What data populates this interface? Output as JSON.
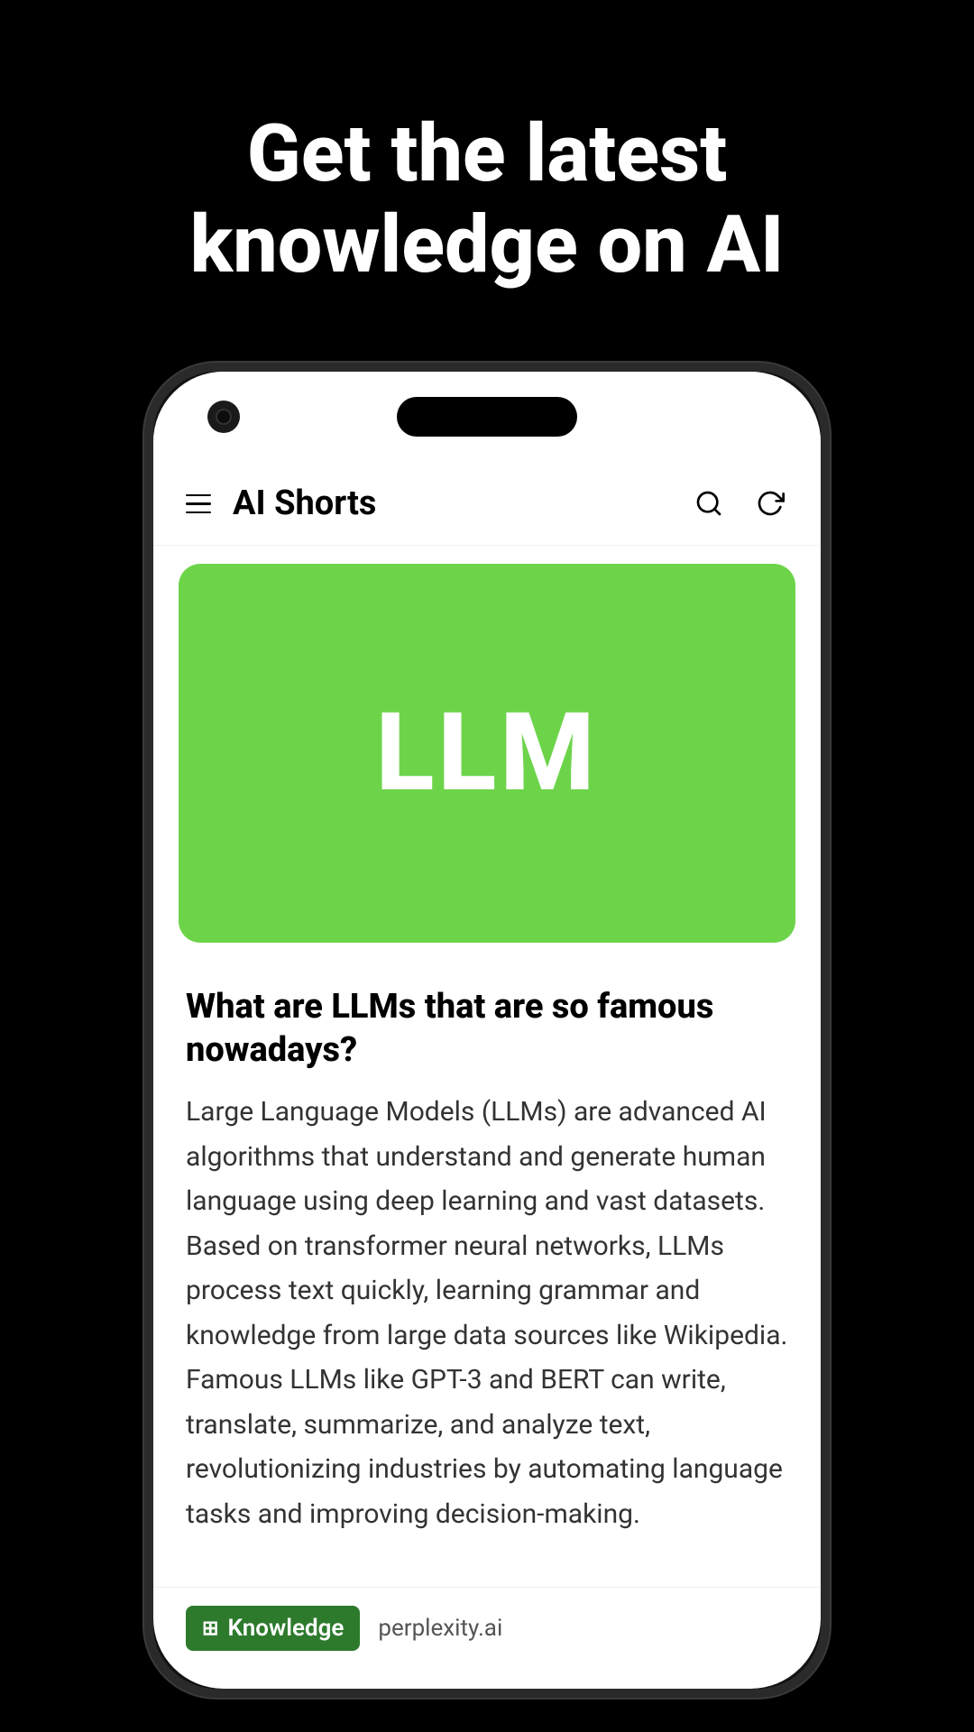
{
  "page": {
    "background_color": "#000000"
  },
  "hero": {
    "title": "Get the latest knowledge on AI"
  },
  "phone": {
    "header": {
      "app_title": "AI Shorts",
      "search_icon": "search",
      "refresh_icon": "refresh",
      "menu_icon": "hamburger"
    },
    "card": {
      "label": "LLM",
      "background_color": "#6dd44a"
    },
    "article": {
      "title": "What are LLMs that are so famous nowadays?",
      "body": "Large Language Models (LLMs) are advanced AI algorithms that understand and generate human language using deep learning and vast datasets. Based on transformer neural networks, LLMs process text quickly, learning grammar and knowledge from large data sources like Wikipedia. Famous LLMs like GPT-3 and BERT can write, translate, summarize, and analyze text, revolutionizing industries by automating language tasks and improving decision-making."
    },
    "footer": {
      "tag_label": "Knowledge",
      "source": "perplexity.ai",
      "tag_bg_color": "#2d7a2d"
    }
  }
}
